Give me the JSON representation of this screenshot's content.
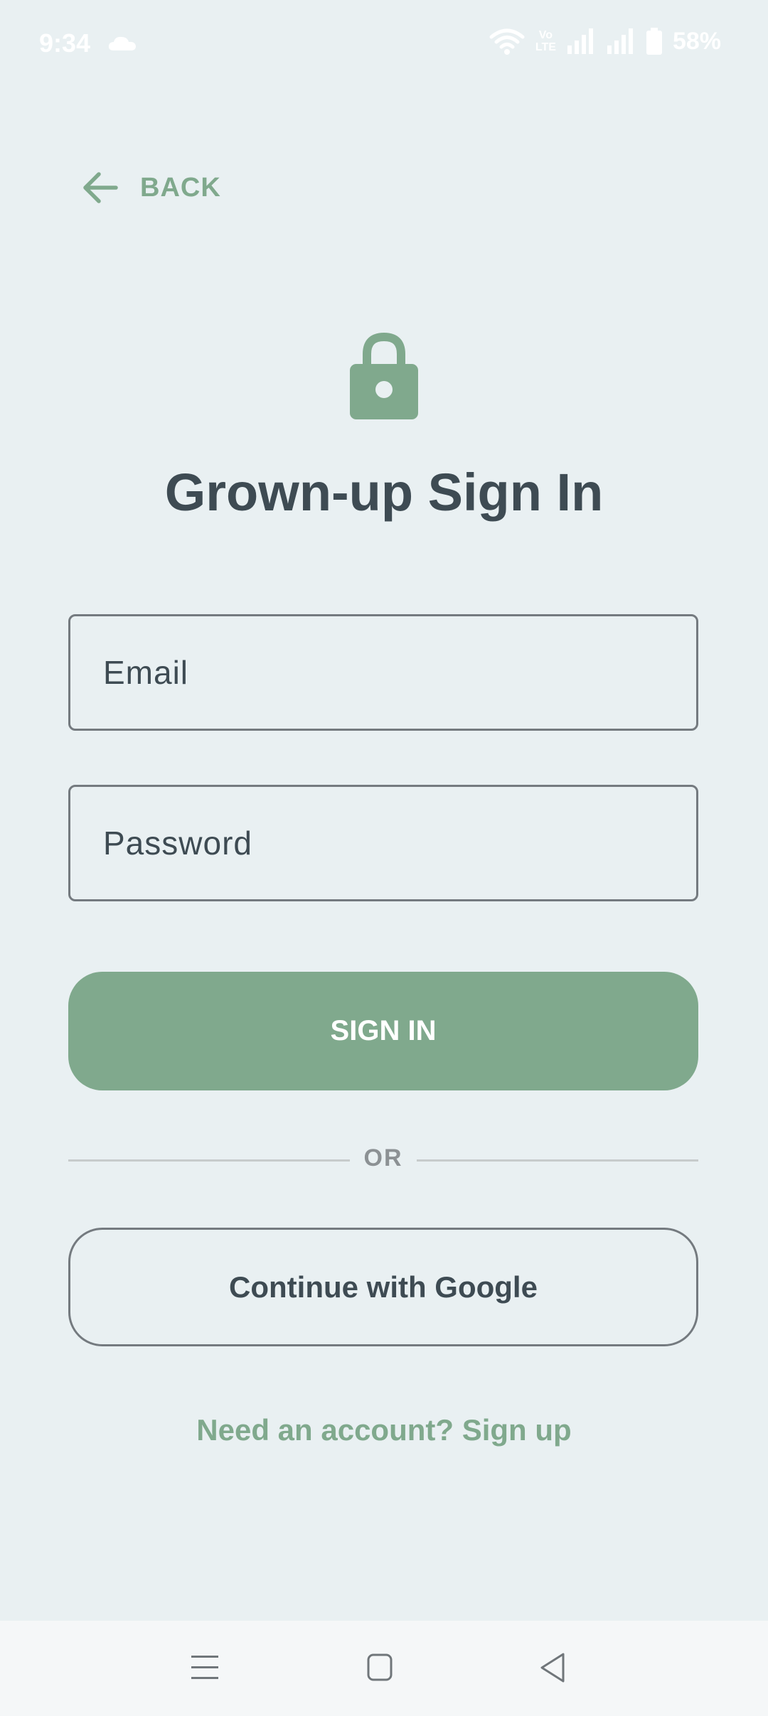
{
  "status_bar": {
    "time": "9:34",
    "weather_icon": "cloud-icon",
    "network_label_top": "Vo",
    "network_label_bottom": "LTE",
    "battery_percent": "58%"
  },
  "back": {
    "label": "BACK",
    "icon": "arrow-left-icon"
  },
  "header": {
    "icon": "lock-icon",
    "title": "Grown-up Sign In"
  },
  "form": {
    "email_placeholder": "Email",
    "password_placeholder": "Password",
    "sign_in_label": "SIGN IN",
    "divider_label": "OR",
    "google_label": "Continue with Google",
    "signup_link": "Need an account? Sign up"
  },
  "nav_bar": {
    "icons": [
      "menu-icon",
      "home-icon",
      "back-triangle-icon"
    ]
  },
  "colors": {
    "accent": "#80a98d",
    "text": "#3e4b53",
    "background": "#e9f0f2"
  }
}
